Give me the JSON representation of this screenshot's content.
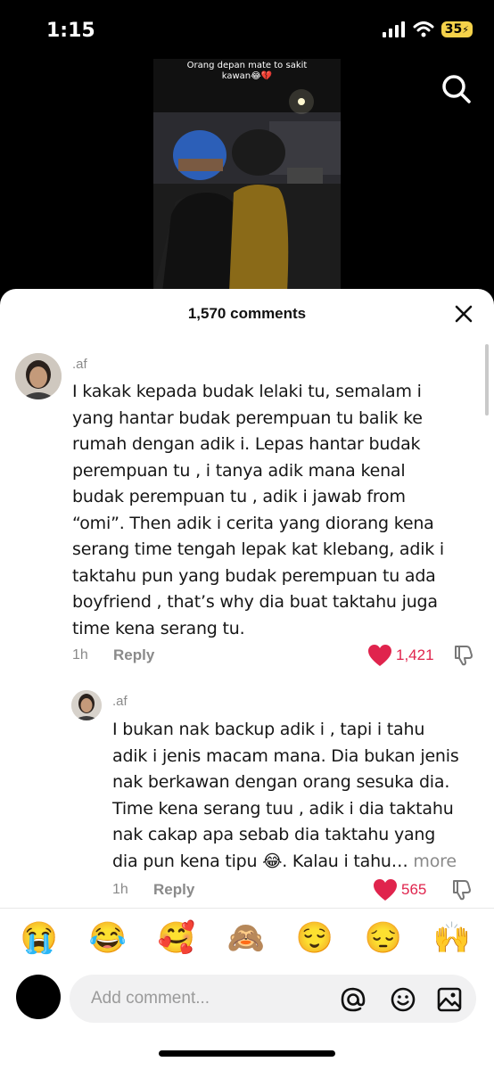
{
  "status_bar": {
    "time": "1:15",
    "battery": "35"
  },
  "video": {
    "caption": "Orang depan mate to sakit\nkawan😂💔"
  },
  "sheet": {
    "title": "1,570 comments"
  },
  "comments": [
    {
      "username": ".af",
      "lines": [
        "I kakak kepada budak lelaki tu, semalam i",
        "yang hantar budak perempuan tu balik ke",
        "rumah dengan adik i. Lepas hantar budak",
        "perempuan tu , i tanya adik mana kenal",
        "budak perempuan tu , adik i jawab from",
        "“omi”. Then adik i cerita yang diorang kena",
        "serang time tengah lepak kat klebang, adik i",
        "taktahu pun yang budak perempuan tu ada",
        "boyfriend , that’s why dia buat taktahu juga",
        "time kena serang tu."
      ],
      "time": "1h",
      "reply": "Reply",
      "likes": "1,421"
    },
    {
      "username": ".af",
      "lines": [
        "I bukan nak backup adik i , tapi i tahu",
        "adik i jenis macam mana. Dia bukan jenis",
        "nak berkawan dengan orang sesuka dia.",
        "Time kena serang tuu , adik i dia taktahu",
        "nak cakap apa sebab dia taktahu yang",
        "dia pun kena tipu 😂. Kalau i tahu…"
      ],
      "more": "more",
      "time": "1h",
      "reply": "Reply",
      "likes": "565"
    }
  ],
  "emojis": [
    "😭",
    "😂",
    "🥰",
    "🙈",
    "😌",
    "😔",
    "🙌"
  ],
  "input": {
    "placeholder": "Add comment..."
  },
  "colors": {
    "accent_like": "#e0244d",
    "battery": "#f5d24a"
  }
}
